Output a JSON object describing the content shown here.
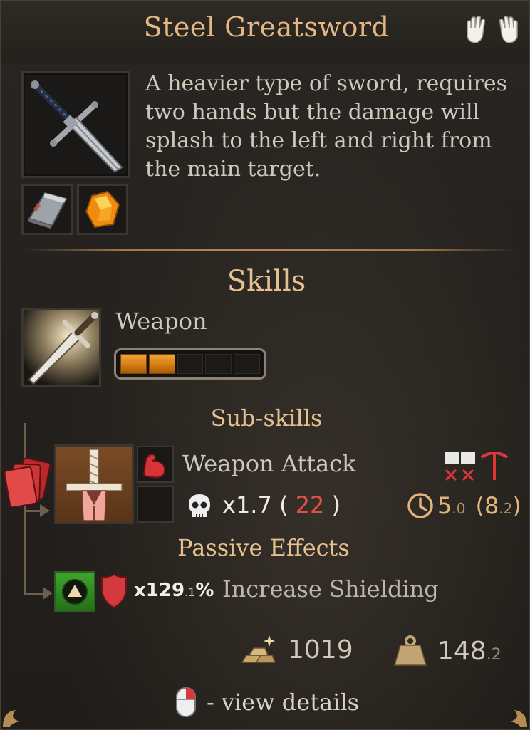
{
  "item": {
    "title": "Steel Greatsword",
    "description": "A heavier type of sword, requires two hands but the damage will splash to the left and right from the main target.",
    "hands_icon": "two-hands-icon",
    "materials": [
      "steel-ingot-icon",
      "amber-gem-icon"
    ]
  },
  "skills": {
    "heading": "Skills",
    "skill_name": "Weapon",
    "progress": {
      "filled": 2,
      "total": 5
    },
    "subskills_heading": "Sub-skills",
    "subskill": {
      "name": "Weapon Attack",
      "multiplier": "x1.7",
      "open_paren": "(",
      "damage": "22",
      "close_paren": ")",
      "time_main": "5",
      "time_main_dec": ".0",
      "time_alt": "(8",
      "time_alt_dec": ".2",
      "time_close": ")"
    }
  },
  "passive": {
    "heading": "Passive Effects",
    "multiplier": "x129",
    "multiplier_dec": ".1",
    "percent": "%",
    "name": "Increase Shielding"
  },
  "stats": {
    "gold": "1019",
    "weight": "148",
    "weight_dec": ".2"
  },
  "footer": {
    "text": "- view details",
    "icon": "mouse-right-click-icon"
  },
  "colors": {
    "title": "#e3b884",
    "heading": "#e6c190",
    "progress_fill": "#e08a1f",
    "damage_red": "#e0504a",
    "passive_green": "#3ea52c"
  }
}
